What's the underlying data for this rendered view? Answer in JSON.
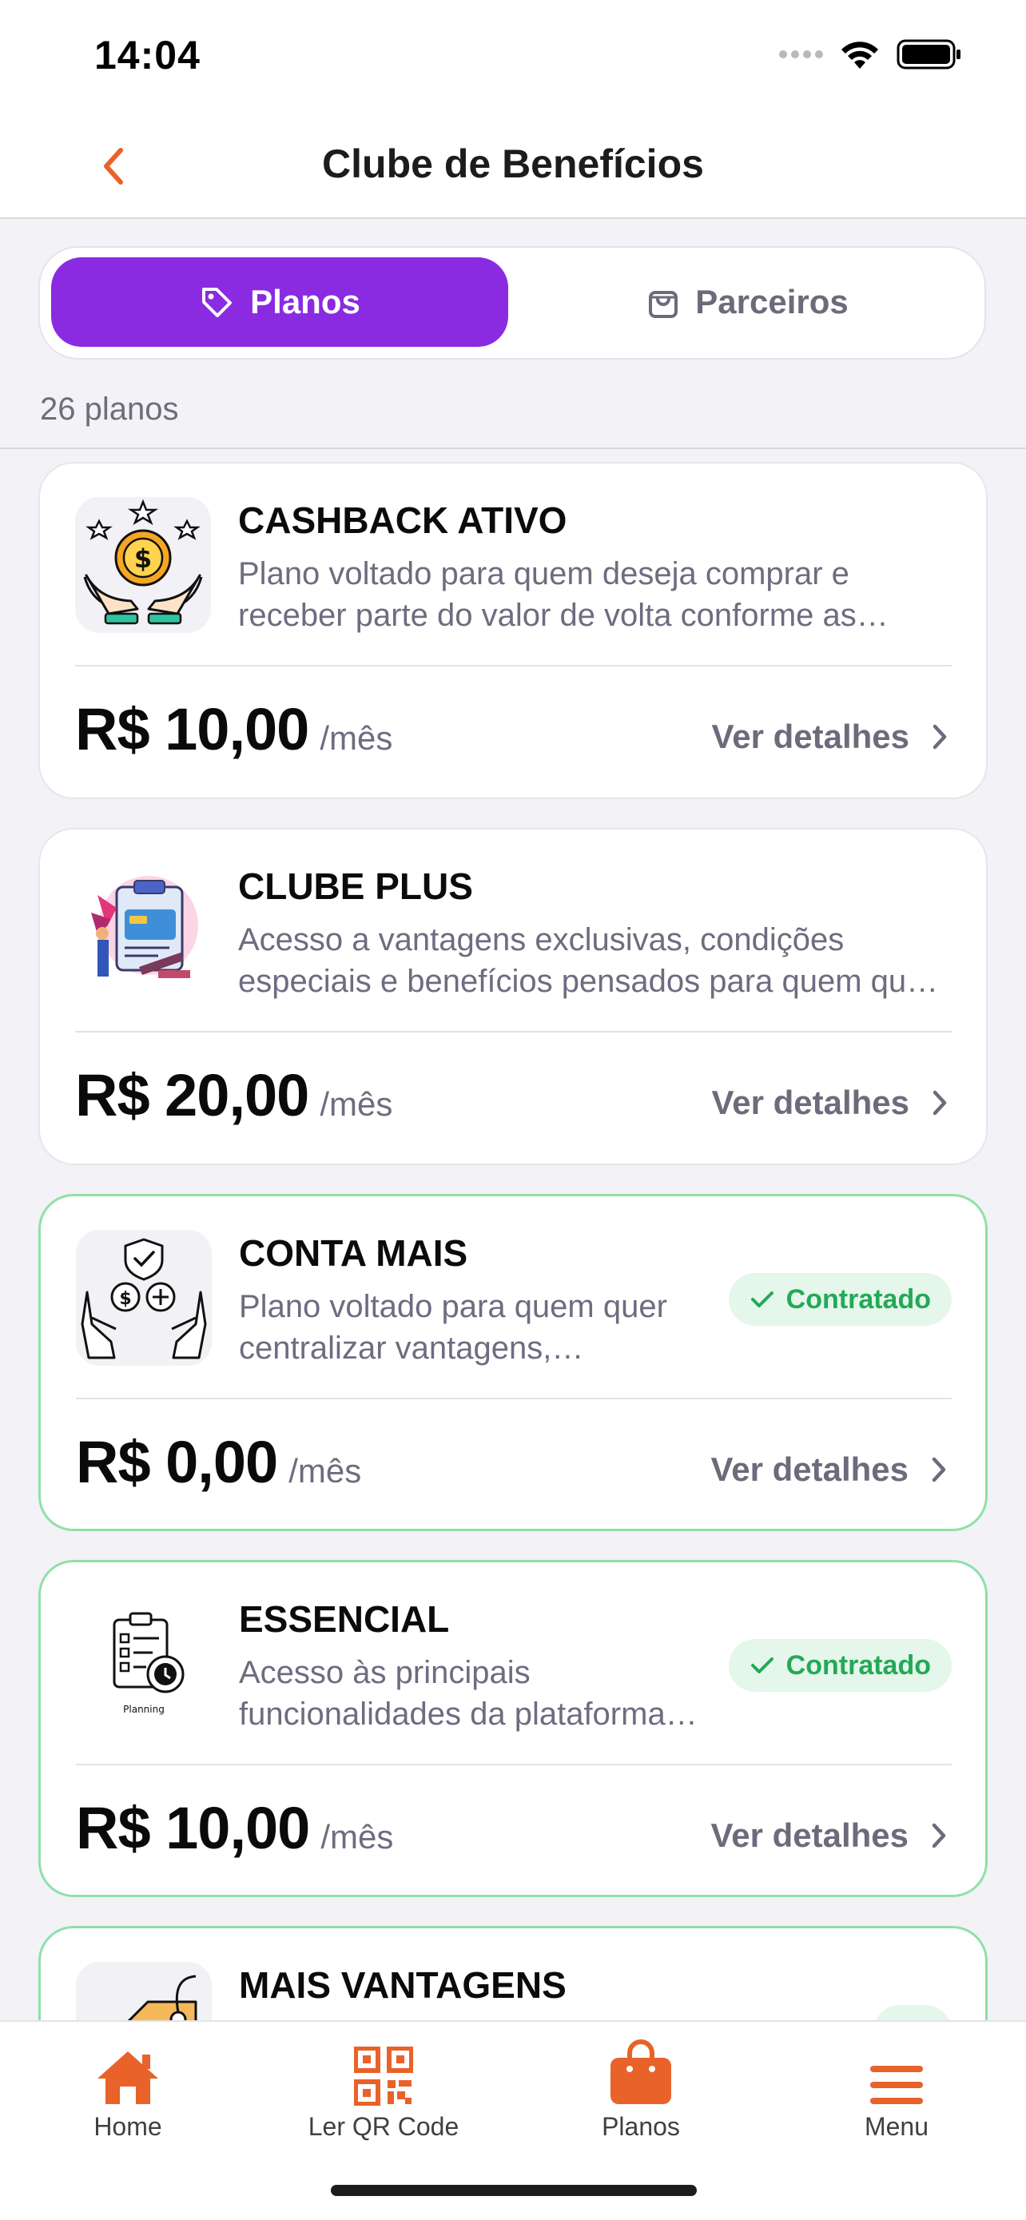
{
  "status_bar": {
    "time": "14:04"
  },
  "header": {
    "title": "Clube de Benefícios"
  },
  "segments": [
    {
      "label": "Planos",
      "icon": "tag-icon",
      "active": true
    },
    {
      "label": "Parceiros",
      "icon": "shopping-bag-icon",
      "active": false
    }
  ],
  "plans_count": "26 planos",
  "plans": [
    {
      "name": "CASHBACK ATIVO",
      "description": "Plano voltado para quem deseja comprar e receber parte do valor de volta conforme as regras do programa de benefícios.",
      "price": "R$ 10,00",
      "period": "/mês",
      "details_label": "Ver detalhes",
      "contracted": false,
      "icon": "cashback-hands-icon"
    },
    {
      "name": "CLUBE PLUS",
      "description": "Acesso a vantagens exclusivas, condições especiais e benefícios pensados para quem quer aproveitar mais.",
      "price": "R$ 20,00",
      "period": "/mês",
      "details_label": "Ver detalhes",
      "contracted": false,
      "icon": "clipboard-card-icon"
    },
    {
      "name": "CONTA MAIS",
      "description": "Plano voltado para quem quer centralizar vantagens, descontos e benefícios em uma única conta.",
      "price": "R$ 0,00",
      "period": "/mês",
      "details_label": "Ver detalhes",
      "contracted": true,
      "badge_label": "Contratado",
      "icon": "money-exchange-icon"
    },
    {
      "name": "ESSENCIAL",
      "description": "Acesso às principais funcionalidades da plataforma com benefícios essenciais para o dia a dia.",
      "price": "R$ 10,00",
      "period": "/mês",
      "details_label": "Ver detalhes",
      "contracted": true,
      "badge_label": "Contratado",
      "icon": "planning-icon",
      "icon_caption": "Planning"
    },
    {
      "name": "MAIS VANTAGENS",
      "description": "",
      "price": "",
      "period": "",
      "details_label": "",
      "contracted": true,
      "badge_label": "",
      "icon": "price-tag-icon"
    }
  ],
  "tabbar": [
    {
      "label": "Home",
      "icon": "home-icon"
    },
    {
      "label": "Ler QR Code",
      "icon": "qr-code-icon"
    },
    {
      "label": "Planos",
      "icon": "shopping-bag-icon"
    },
    {
      "label": "Menu",
      "icon": "menu-icon"
    }
  ],
  "colors": {
    "accent_purple": "#8a2be2",
    "accent_orange": "#e8622a",
    "contracted_green": "#23a957",
    "background": "#f2f2f7"
  }
}
